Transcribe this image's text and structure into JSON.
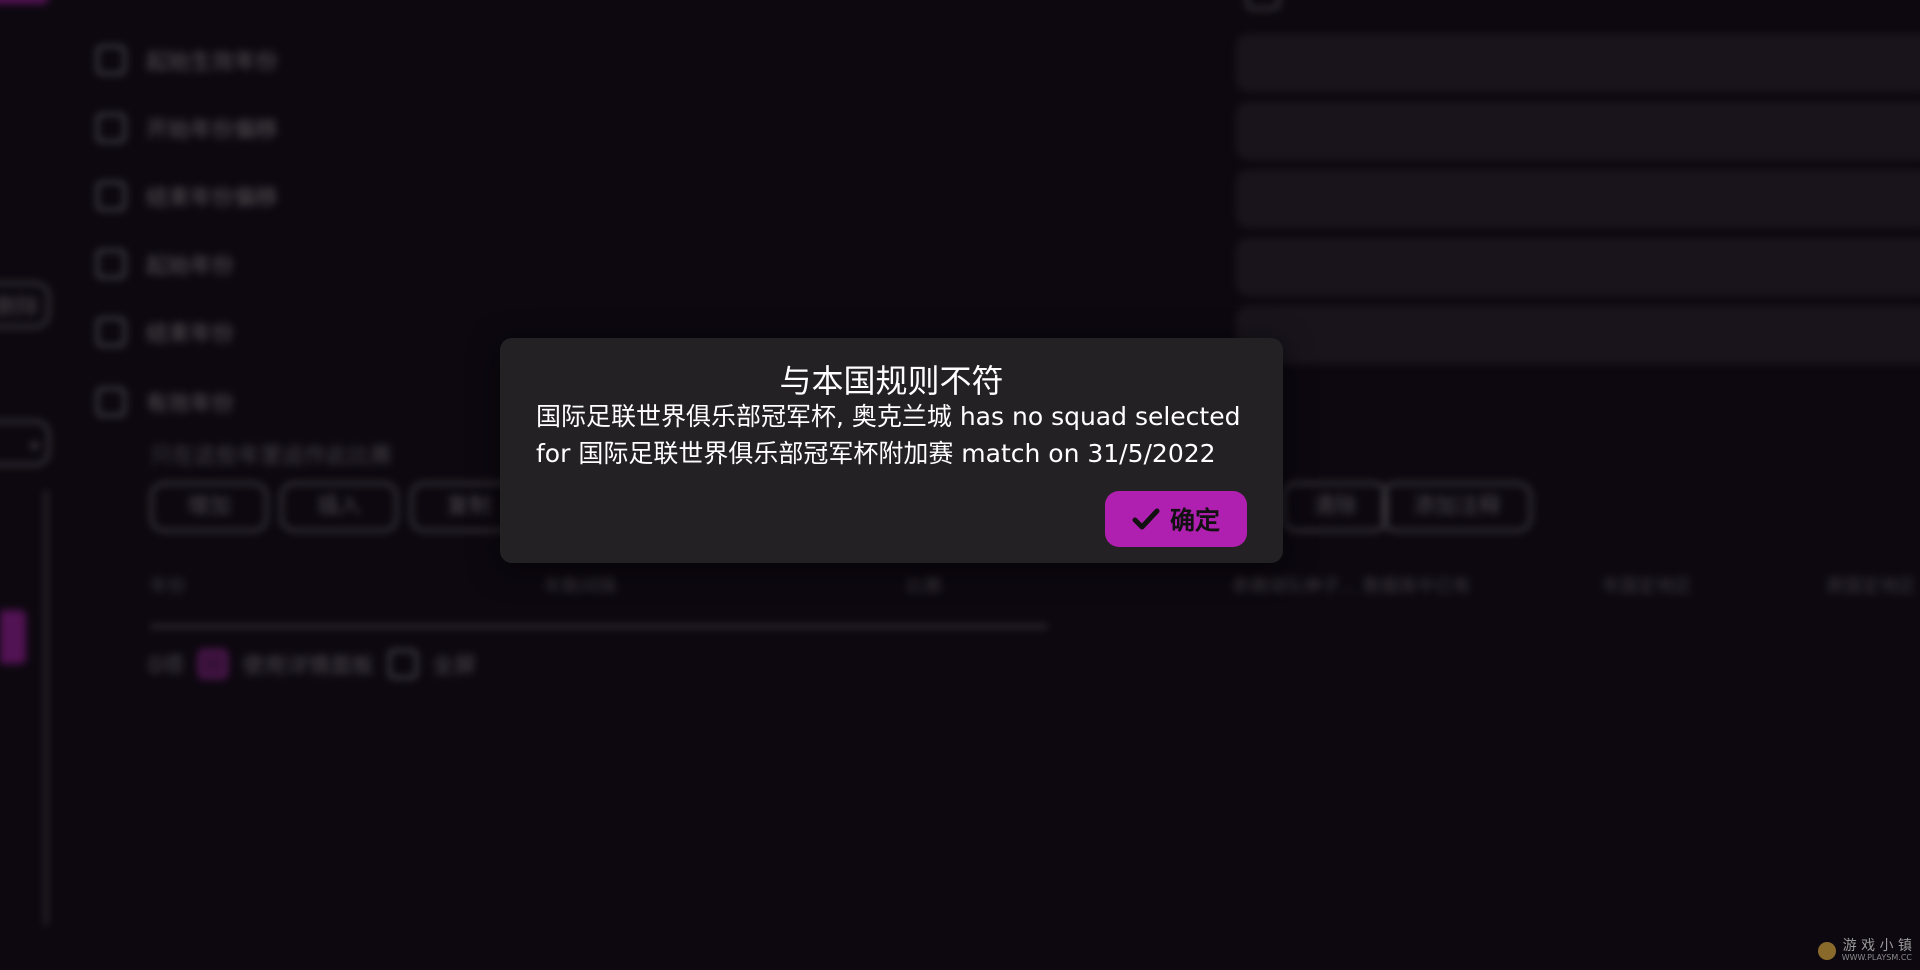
{
  "dialog": {
    "title": "与本国规则不符",
    "message_line1": "国际足联世界俱乐部冠军杯, 奥克兰城 has no squad selected",
    "message_line2": "for 国际足联世界俱乐部冠军杯附加赛 match on 31/5/2022",
    "ok_label": "确定"
  },
  "background": {
    "left_pills": [
      "删除",
      ""
    ],
    "checkbox_rows": [
      "起始生效年份",
      "开始年份偏移",
      "结束年份偏移",
      "起始年份",
      "结束年份",
      "有效年份"
    ],
    "hint": "只在这些年里运作此比赛",
    "buttons": [
      "增加",
      "插入",
      "复制"
    ],
    "buttons_right": [
      "清除",
      "添加注释"
    ],
    "columns": [
      "年份",
      "年数间隔",
      "比赛",
      "参赛球队种子... 数据库中已有",
      "年国定地区",
      "原国定地区"
    ],
    "items_count": "0项",
    "use_details_panel": "使用详情面板",
    "fullscreen": "全屏"
  },
  "watermark": {
    "text": "游 戏 小 镇",
    "url": "WWW.PLAYSM.CC"
  },
  "colors": {
    "accent": "#b020b0",
    "modal_bg": "#232124",
    "page_bg": "#0d0810"
  }
}
